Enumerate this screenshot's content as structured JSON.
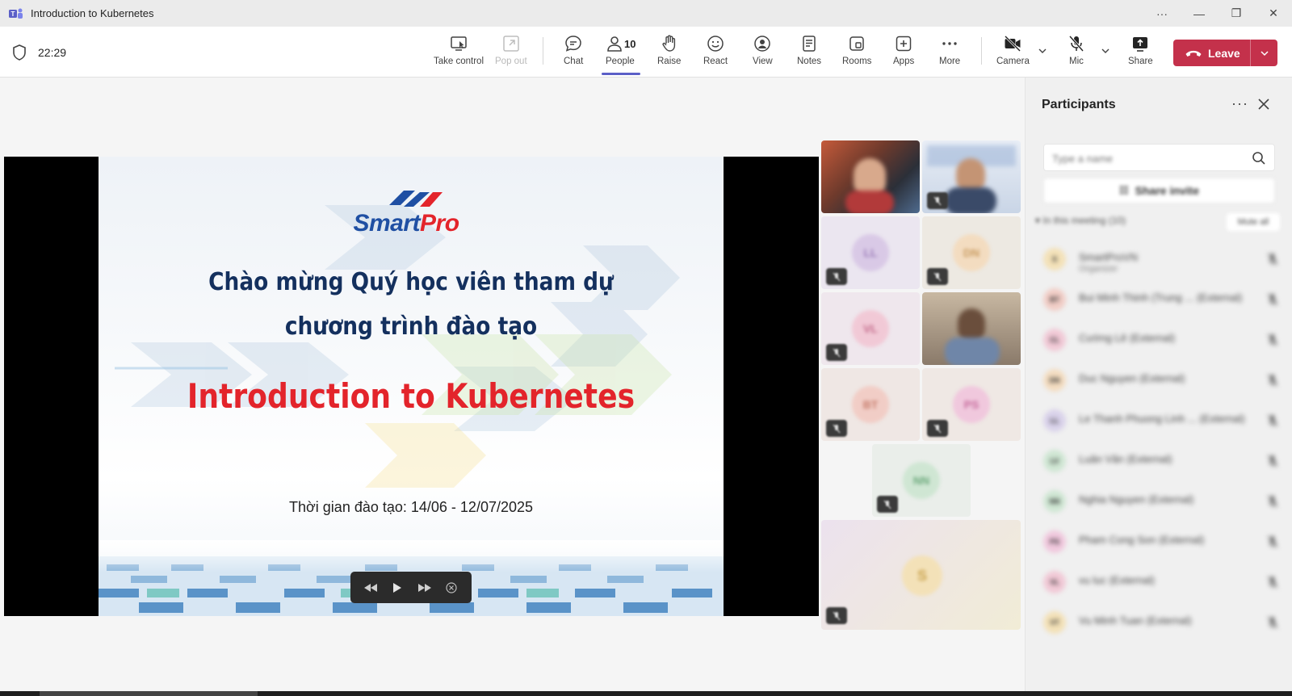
{
  "window": {
    "title": "Introduction to Kubernetes",
    "controls": [
      "···",
      "—",
      "❐",
      "✕"
    ]
  },
  "toolbar": {
    "timer": "22:29",
    "buttons": {
      "take_control": "Take control",
      "pop_out": "Pop out",
      "chat": "Chat",
      "people": "People",
      "people_count": "10",
      "raise": "Raise",
      "react": "React",
      "view": "View",
      "notes": "Notes",
      "rooms": "Rooms",
      "apps": "Apps",
      "more": "More",
      "camera": "Camera",
      "mic": "Mic",
      "share": "Share",
      "leave": "Leave"
    },
    "active_tab": "People",
    "leave_color": "#c4314b",
    "accent_color": "#5b5fc7"
  },
  "slide": {
    "logo_smart": "Smart",
    "logo_pro": "Pro",
    "welcome_line1": "Chào mừng Quý học viên tham dự",
    "welcome_line2": "chương trình đào tạo",
    "course_title": "Introduction to Kubernetes",
    "date_line": "Thời gian đào tạo: 14/06 - 12/07/2025",
    "title_color": "#e3242b",
    "heading_color": "#14305e"
  },
  "gallery": {
    "tiles": [
      {
        "initials": "LL",
        "color": "#d9c9e6",
        "text_color": "#9a7bb8"
      },
      {
        "initials": "DN",
        "color": "#f3dcc0",
        "text_color": "#c89a5e"
      },
      {
        "initials": "VL",
        "color": "#f1c9d6",
        "text_color": "#c36a8a"
      },
      {
        "initials": "BT",
        "color": "#f1cdc6",
        "text_color": "#c67a6a"
      },
      {
        "initials": "PS",
        "color": "#f0c8dd",
        "text_color": "#c66a9c"
      },
      {
        "initials": "NN",
        "color": "#cfe6d3",
        "text_color": "#6aa87a"
      },
      {
        "initials": "S",
        "color": "#f3e1b8",
        "text_color": "#c9a24c"
      }
    ]
  },
  "participants": {
    "title": "Participants",
    "more_label": "···",
    "search_placeholder": "Type a name",
    "share_invite": "Share invite",
    "section_label": "In this meeting (10)",
    "mute_all": "Mute all",
    "list": [
      {
        "initials": "S",
        "name": "SmartProVN",
        "sub": "Organizer",
        "color": "#f3e1b8"
      },
      {
        "initials": "BT",
        "name": "Bui Minh Thinh (Trung ... (External)",
        "sub": "",
        "color": "#f1cdc6"
      },
      {
        "initials": "CL",
        "name": "Cường Lê (External)",
        "sub": "",
        "color": "#f1c9d6"
      },
      {
        "initials": "DN",
        "name": "Duc Nguyen (External)",
        "sub": "",
        "color": "#f3dcc0"
      },
      {
        "initials": "LL",
        "name": "Le Thanh Phuong Linh ... (External)",
        "sub": "",
        "color": "#d9d2ea"
      },
      {
        "initials": "LV",
        "name": "Luân Văn (External)",
        "sub": "",
        "color": "#cfe6d3"
      },
      {
        "initials": "NN",
        "name": "Nghia Nguyen (External)",
        "sub": "",
        "color": "#cfe6d3"
      },
      {
        "initials": "PS",
        "name": "Pham Cong Son (External)",
        "sub": "",
        "color": "#f0c8dd"
      },
      {
        "initials": "VL",
        "name": "vu luc (External)",
        "sub": "",
        "color": "#f1c9d6"
      },
      {
        "initials": "VT",
        "name": "Vu Minh Tuan (External)",
        "sub": "",
        "color": "#f3e1b8"
      }
    ]
  }
}
